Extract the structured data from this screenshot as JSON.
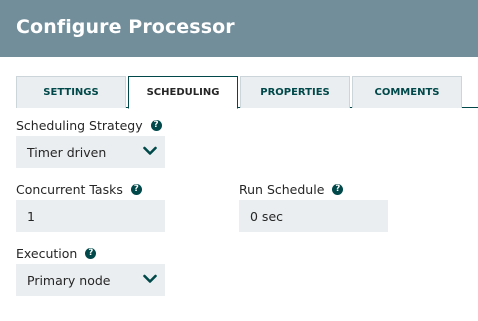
{
  "header": {
    "title": "Configure Processor"
  },
  "tabs": [
    {
      "label": "SETTINGS",
      "active": false
    },
    {
      "label": "SCHEDULING",
      "active": true
    },
    {
      "label": "PROPERTIES",
      "active": false
    },
    {
      "label": "COMMENTS",
      "active": false
    }
  ],
  "form": {
    "scheduling_strategy": {
      "label": "Scheduling Strategy",
      "value": "Timer driven",
      "icon": "help-icon"
    },
    "concurrent_tasks": {
      "label": "Concurrent Tasks",
      "value": "1",
      "icon": "help-icon"
    },
    "run_schedule": {
      "label": "Run Schedule",
      "value": "0 sec",
      "icon": "help-icon"
    },
    "execution": {
      "label": "Execution",
      "value": "Primary node",
      "icon": "help-icon"
    }
  },
  "colors": {
    "header_bg": "#728e9b",
    "accent": "#004849",
    "field_bg": "#eaeef0"
  }
}
